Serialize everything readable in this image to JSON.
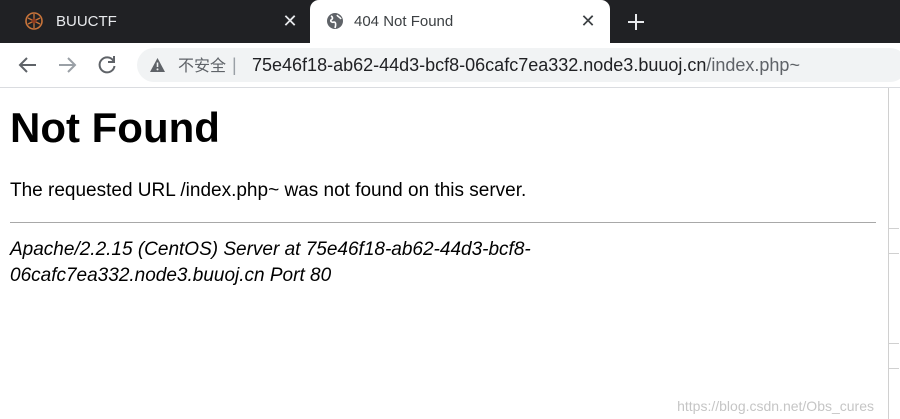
{
  "tabs": [
    {
      "title": "BUUCTF",
      "active": false
    },
    {
      "title": "404 Not Found",
      "active": true
    }
  ],
  "toolbar": {
    "security_label": "不安全",
    "separator": "|",
    "url_host": "75e46f18-ab62-44d3-bcf8-06cafc7ea332.node3.buuoj.cn",
    "url_path": "/index.php~"
  },
  "page": {
    "heading": "Not Found",
    "message": "The requested URL /index.php~ was not found on this server.",
    "server_signature": "Apache/2.2.15 (CentOS) Server at 75e46f18-ab62-44d3-bcf8-06cafc7ea332.node3.buuoj.cn Port 80"
  },
  "watermark": "https://blog.csdn.net/Obs_cures",
  "icons": {
    "inactive_tab_favicon": "buuctf-logo-icon",
    "active_tab_favicon": "globe-icon",
    "close": "close-icon",
    "new_tab": "plus-icon",
    "back": "arrow-left-icon",
    "forward": "arrow-right-icon",
    "reload": "reload-icon",
    "security": "warning-triangle-icon"
  }
}
